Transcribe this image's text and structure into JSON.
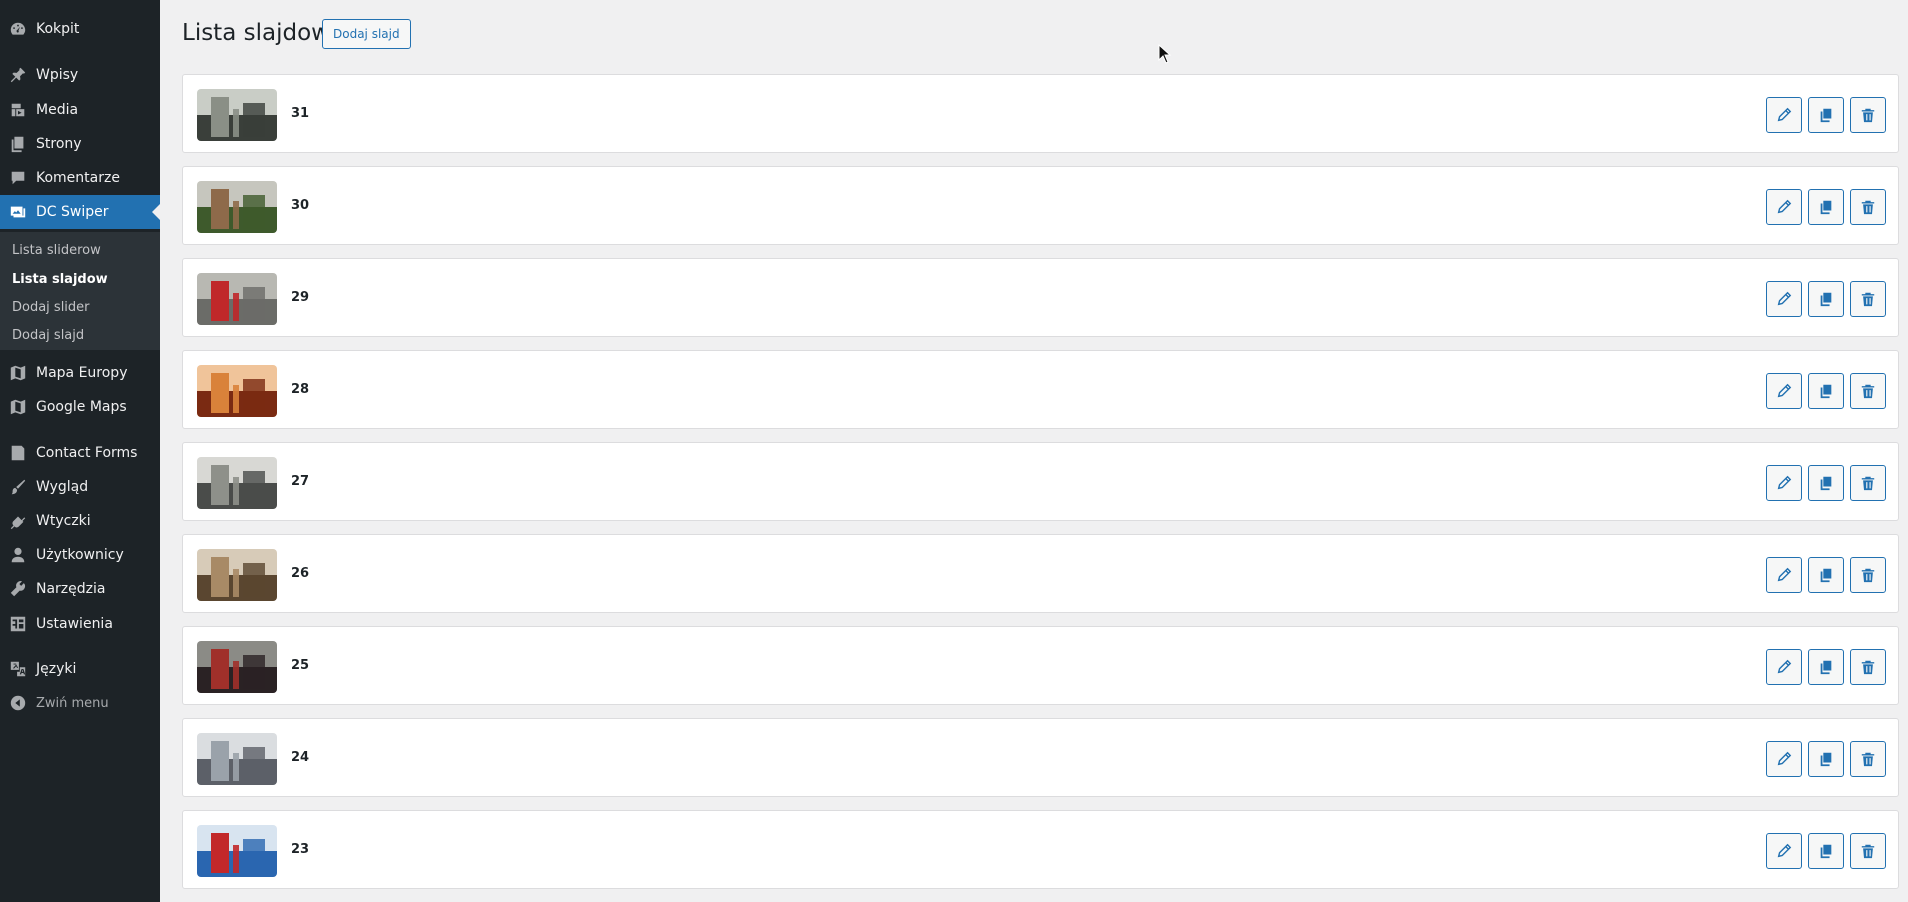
{
  "sidebar": {
    "items": [
      {
        "label": "Kokpit",
        "icon": "dashboard-icon"
      },
      {
        "label": "Wpisy",
        "icon": "pin-icon"
      },
      {
        "label": "Media",
        "icon": "media-icon"
      },
      {
        "label": "Strony",
        "icon": "pages-icon"
      },
      {
        "label": "Komentarze",
        "icon": "comment-icon"
      },
      {
        "label": "DC Swiper",
        "icon": "images-icon"
      },
      {
        "label": "Mapa Europy",
        "icon": "map-icon"
      },
      {
        "label": "Google Maps",
        "icon": "map-icon"
      },
      {
        "label": "Contact Forms",
        "icon": "form-icon"
      },
      {
        "label": "Wygląd",
        "icon": "brush-icon"
      },
      {
        "label": "Wtyczki",
        "icon": "plugin-icon"
      },
      {
        "label": "Użytkownicy",
        "icon": "user-icon"
      },
      {
        "label": "Narzędzia",
        "icon": "wrench-icon"
      },
      {
        "label": "Ustawienia",
        "icon": "settings-icon"
      },
      {
        "label": "Języki",
        "icon": "translate-icon"
      },
      {
        "label": "Zwiń menu",
        "icon": "collapse-icon"
      }
    ],
    "submenu": [
      {
        "label": "Lista sliderow"
      },
      {
        "label": "Lista slajdow"
      },
      {
        "label": "Dodaj slider"
      },
      {
        "label": "Dodaj slajd"
      }
    ]
  },
  "main": {
    "title": "Lista slajdow",
    "add_button": "Dodaj slajd",
    "slides": [
      {
        "number": "31",
        "thumb_colors": [
          "#3a3f3a",
          "#8a8f86",
          "#c9cdc6"
        ]
      },
      {
        "number": "30",
        "thumb_colors": [
          "#3e5a2c",
          "#8e6a4a",
          "#c6c6be"
        ]
      },
      {
        "number": "29",
        "thumb_colors": [
          "#6b6c68",
          "#c0282a",
          "#b8b8b2"
        ]
      },
      {
        "number": "28",
        "thumb_colors": [
          "#7a2a12",
          "#d9823a",
          "#f0c49a"
        ]
      },
      {
        "number": "27",
        "thumb_colors": [
          "#4a4c4a",
          "#8e908a",
          "#d8d8d4"
        ]
      },
      {
        "number": "26",
        "thumb_colors": [
          "#5a4630",
          "#a88a66",
          "#d7cbb8"
        ]
      },
      {
        "number": "25",
        "thumb_colors": [
          "#2a2224",
          "#a0302a",
          "#8b8b86"
        ]
      },
      {
        "number": "24",
        "thumb_colors": [
          "#5c6068",
          "#9aa2aa",
          "#dadde0"
        ]
      },
      {
        "number": "23",
        "thumb_colors": [
          "#2a66b0",
          "#c2282a",
          "#d8e4f0"
        ]
      }
    ],
    "actions": {
      "edit": "edit-icon",
      "duplicate": "duplicate-icon",
      "delete": "trash-icon"
    }
  },
  "colors": {
    "accent": "#2271b1",
    "sidebar_bg": "#1d2327",
    "submenu_bg": "#2c3338",
    "page_bg": "#f0f0f1"
  }
}
